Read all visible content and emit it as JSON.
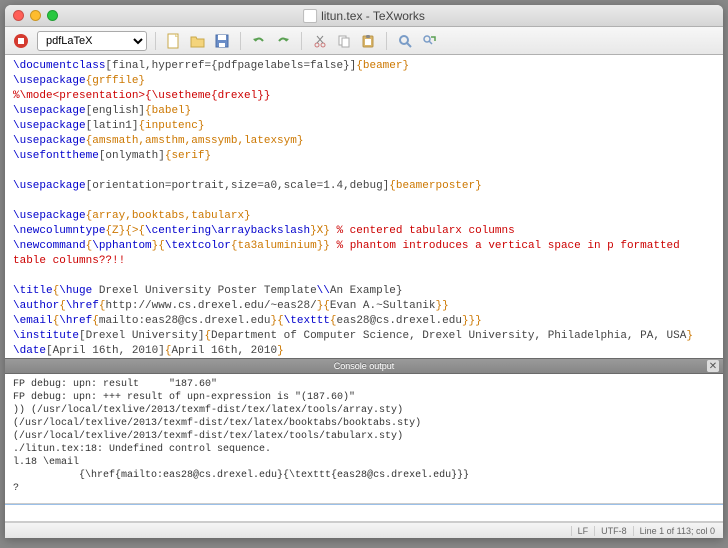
{
  "window": {
    "title": "litun.tex - TeXworks"
  },
  "toolbar": {
    "engine": "pdfLaTeX"
  },
  "editor": {
    "lines": [
      {
        "t": "code",
        "segs": [
          [
            "cmd",
            "\\documentclass"
          ],
          [
            "opt",
            "[final,hyperref={pdfpagelabels=false}]"
          ],
          [
            "grp",
            "{beamer}"
          ]
        ]
      },
      {
        "t": "code",
        "segs": [
          [
            "cmd",
            "\\usepackage"
          ],
          [
            "grp",
            "{grffile}"
          ]
        ]
      },
      {
        "t": "comment",
        "text": "%\\mode<presentation>{\\usetheme{drexel}}"
      },
      {
        "t": "code",
        "segs": [
          [
            "cmd",
            "\\usepackage"
          ],
          [
            "opt",
            "[english]"
          ],
          [
            "grp",
            "{babel}"
          ]
        ]
      },
      {
        "t": "code",
        "segs": [
          [
            "cmd",
            "\\usepackage"
          ],
          [
            "opt",
            "[latin1]"
          ],
          [
            "grp",
            "{inputenc}"
          ]
        ]
      },
      {
        "t": "code",
        "segs": [
          [
            "cmd",
            "\\usepackage"
          ],
          [
            "grp",
            "{amsmath,amsthm,amssymb,latexsym}"
          ]
        ]
      },
      {
        "t": "code",
        "segs": [
          [
            "cmd",
            "\\usefonttheme"
          ],
          [
            "opt",
            "[onlymath]"
          ],
          [
            "grp",
            "{serif}"
          ]
        ]
      },
      {
        "t": "blank"
      },
      {
        "t": "code",
        "segs": [
          [
            "cmd",
            "\\usepackage"
          ],
          [
            "opt",
            "[orientation=portrait,size=a0,scale=1.4,debug]"
          ],
          [
            "grp",
            "{beamerposter}"
          ]
        ]
      },
      {
        "t": "blank"
      },
      {
        "t": "code",
        "segs": [
          [
            "cmd",
            "\\usepackage"
          ],
          [
            "grp",
            "{array,booktabs,tabularx}"
          ]
        ]
      },
      {
        "t": "code",
        "segs": [
          [
            "cmd",
            "\\newcolumntype"
          ],
          [
            "grp",
            "{Z}{>{"
          ],
          [
            "cmd",
            "\\centering\\arraybackslash"
          ],
          [
            "grp",
            "}X}"
          ],
          [
            "red",
            " % centered tabularx columns"
          ]
        ]
      },
      {
        "t": "code",
        "segs": [
          [
            "cmd",
            "\\newcommand"
          ],
          [
            "grp",
            "{"
          ],
          [
            "cmd",
            "\\pphantom"
          ],
          [
            "grp",
            "}{"
          ],
          [
            "cmd",
            "\\textcolor"
          ],
          [
            "grp",
            "{ta3aluminium}}"
          ],
          [
            "red",
            " % phantom introduces a vertical space in p formatted"
          ]
        ]
      },
      {
        "t": "red",
        "text": "table columns??!!"
      },
      {
        "t": "blank"
      },
      {
        "t": "code",
        "segs": [
          [
            "cmd",
            "\\title"
          ],
          [
            "grp",
            "{"
          ],
          [
            "cmd",
            "\\huge"
          ],
          [
            "opt",
            " Drexel University Poster Template"
          ],
          [
            "cmd",
            "\\\\"
          ],
          [
            "opt",
            "An Example}"
          ]
        ]
      },
      {
        "t": "code",
        "segs": [
          [
            "cmd",
            "\\author"
          ],
          [
            "grp",
            "{"
          ],
          [
            "cmd",
            "\\href"
          ],
          [
            "grp",
            "{"
          ],
          [
            "opt",
            "http://www.cs.drexel.edu/~eas28/"
          ],
          [
            "grp",
            "}{"
          ],
          [
            "opt",
            "Evan A.~Sultanik"
          ],
          [
            "grp",
            "}}"
          ]
        ]
      },
      {
        "t": "code",
        "segs": [
          [
            "cmd",
            "\\email"
          ],
          [
            "grp",
            "{"
          ],
          [
            "cmd",
            "\\href"
          ],
          [
            "grp",
            "{"
          ],
          [
            "opt",
            "mailto:eas28@cs.drexel.edu"
          ],
          [
            "grp",
            "}{"
          ],
          [
            "cmd",
            "\\texttt"
          ],
          [
            "grp",
            "{"
          ],
          [
            "opt",
            "eas28@cs.drexel.edu"
          ],
          [
            "grp",
            "}}}"
          ]
        ]
      },
      {
        "t": "code",
        "segs": [
          [
            "cmd",
            "\\institute"
          ],
          [
            "opt",
            "[Drexel University]"
          ],
          [
            "grp",
            "{"
          ],
          [
            "opt",
            "Department of Computer Science, Drexel University, Philadelphia, PA, USA"
          ],
          [
            "grp",
            "}"
          ]
        ]
      },
      {
        "t": "code",
        "segs": [
          [
            "cmd",
            "\\date"
          ],
          [
            "opt",
            "[April 16th, 2010]"
          ],
          [
            "grp",
            "{"
          ],
          [
            "opt",
            "April 16th, 2010"
          ],
          [
            "grp",
            "}"
          ]
        ]
      }
    ]
  },
  "console": {
    "header": "Console output",
    "lines": [
      "FP debug: upn: result     \"187.60\"",
      "FP debug: upn: +++ result of upn-expression is \"(187.60)\"",
      ")) (/usr/local/texlive/2013/texmf-dist/tex/latex/tools/array.sty)",
      "(/usr/local/texlive/2013/texmf-dist/tex/latex/booktabs/booktabs.sty)",
      "(/usr/local/texlive/2013/texmf-dist/tex/latex/tools/tabularx.sty)",
      "./litun.tex:18: Undefined control sequence.",
      "l.18 \\email",
      "           {\\href{mailto:eas28@cs.drexel.edu}{\\texttt{eas28@cs.drexel.edu}}}",
      "?"
    ]
  },
  "statusbar": {
    "lineending": "LF",
    "encoding": "UTF-8",
    "position": "Line 1 of 113; col 0"
  }
}
